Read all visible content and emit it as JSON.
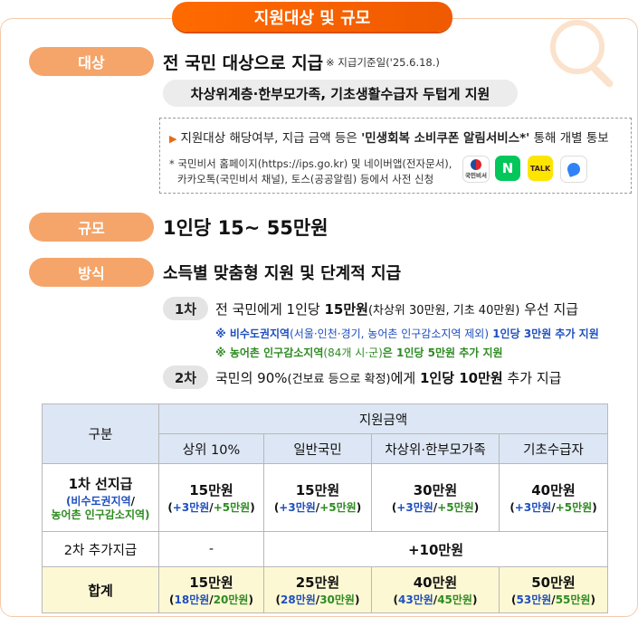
{
  "title": "지원대상 및 규모",
  "target": {
    "label": "대상",
    "heading": "전 국민 대상으로 지급",
    "note": "※ 지급기준일('25.6.18.)",
    "emphasis": "차상위계층·한부모가족, 기초생활수급자 두텁게 지원",
    "notice_prefix": "지원대상 해당여부, 지급 금액 등은 ",
    "notice_bold": "'민생회복 소비쿠폰 알림서비스*'",
    "notice_suffix": " 통해 개별 통보",
    "apply_line1": "* 국민비서 홈페이지(https://ips.go.kr) 및 네이버앱(전자문서),",
    "apply_line2": "카카오톡(국민비서 채널), 토스(공공알림) 등에서 사전 신청",
    "apps": [
      {
        "name": "국민비서",
        "icon": "gov-secretary-icon",
        "color": "#ffffff"
      },
      {
        "name": "N",
        "icon": "naver-icon",
        "color": "#03c75a"
      },
      {
        "name": "TALK",
        "icon": "kakaotalk-icon",
        "color": "#fee500"
      },
      {
        "name": "toss",
        "icon": "toss-icon",
        "color": "#3182f6"
      }
    ]
  },
  "scale": {
    "label": "규모",
    "heading": "1인당 15~ 55만원"
  },
  "method": {
    "label": "방식",
    "heading": "소득별 맞춤형 지원 및 단계적 지급",
    "round1": {
      "label": "1차",
      "text_a": "전 국민에게 1인당 ",
      "text_b": "15만원",
      "text_c": "(차상위 30만원, 기초 40만원)",
      "text_d": " 우선 지급",
      "note1_a": "※ 비수도권지역",
      "note1_b": "(서울·인천·경기, 농어촌 인구감소지역 제외)",
      "note1_c": " 1인당 3만원 추가 지원",
      "note2_a": "※ 농어촌 인구감소지역",
      "note2_b": "(84개 시·군)",
      "note2_c": "은 1인당 5만원 추가 지원"
    },
    "round2": {
      "label": "2차",
      "text_a": "국민의 90%",
      "text_b": "(건보료 등으로 확정)",
      "text_c": "에게 ",
      "text_d": "1인당 10만원",
      "text_e": " 추가 지급"
    }
  },
  "table": {
    "col_category": "구분",
    "col_group": "지원금액",
    "columns": [
      "상위 10%",
      "일반국민",
      "차상위·한부모가족",
      "기초수급자"
    ],
    "row1": {
      "label": "1차 선지급",
      "sub_blue": "(비수도권지역",
      "sub_slash": "/",
      "sub_green": "농어촌 인구감소지역)",
      "cells": [
        {
          "main": "15만원",
          "a": "+3만원",
          "b": "+5만원"
        },
        {
          "main": "15만원",
          "a": "+3만원",
          "b": "+5만원"
        },
        {
          "main": "30만원",
          "a": "+3만원",
          "b": "+5만원"
        },
        {
          "main": "40만원",
          "a": "+3만원",
          "b": "+5만원"
        }
      ]
    },
    "row2": {
      "label": "2차 추가지급",
      "first": "-",
      "rest": "+10만원"
    },
    "row3": {
      "label": "합계",
      "cells": [
        {
          "main": "15만원",
          "a": "18만원",
          "b": "20만원"
        },
        {
          "main": "25만원",
          "a": "28만원",
          "b": "30만원"
        },
        {
          "main": "40만원",
          "a": "43만원",
          "b": "45만원"
        },
        {
          "main": "50만원",
          "a": "53만원",
          "b": "55만원"
        }
      ]
    }
  }
}
